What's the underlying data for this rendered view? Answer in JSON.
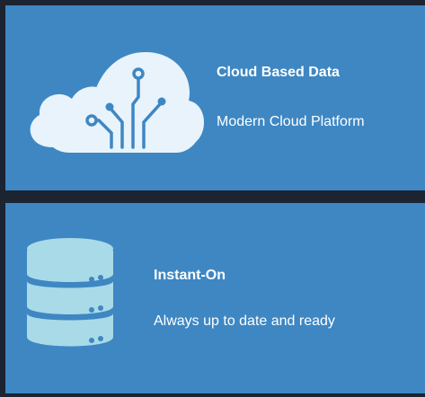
{
  "cards": [
    {
      "icon": "cloud-circuit-icon",
      "title": "Cloud Based Data",
      "subtitle": "Modern Cloud Platform"
    },
    {
      "icon": "database-icon",
      "title": "Instant-On",
      "subtitle": "Always up to date and ready"
    }
  ],
  "colors": {
    "background": "#1c2431",
    "card": "#3e87c3",
    "icon_fill": "#e8f3fb",
    "icon_stroke": "#3e87c3",
    "db_fill": "#a9dae8"
  }
}
